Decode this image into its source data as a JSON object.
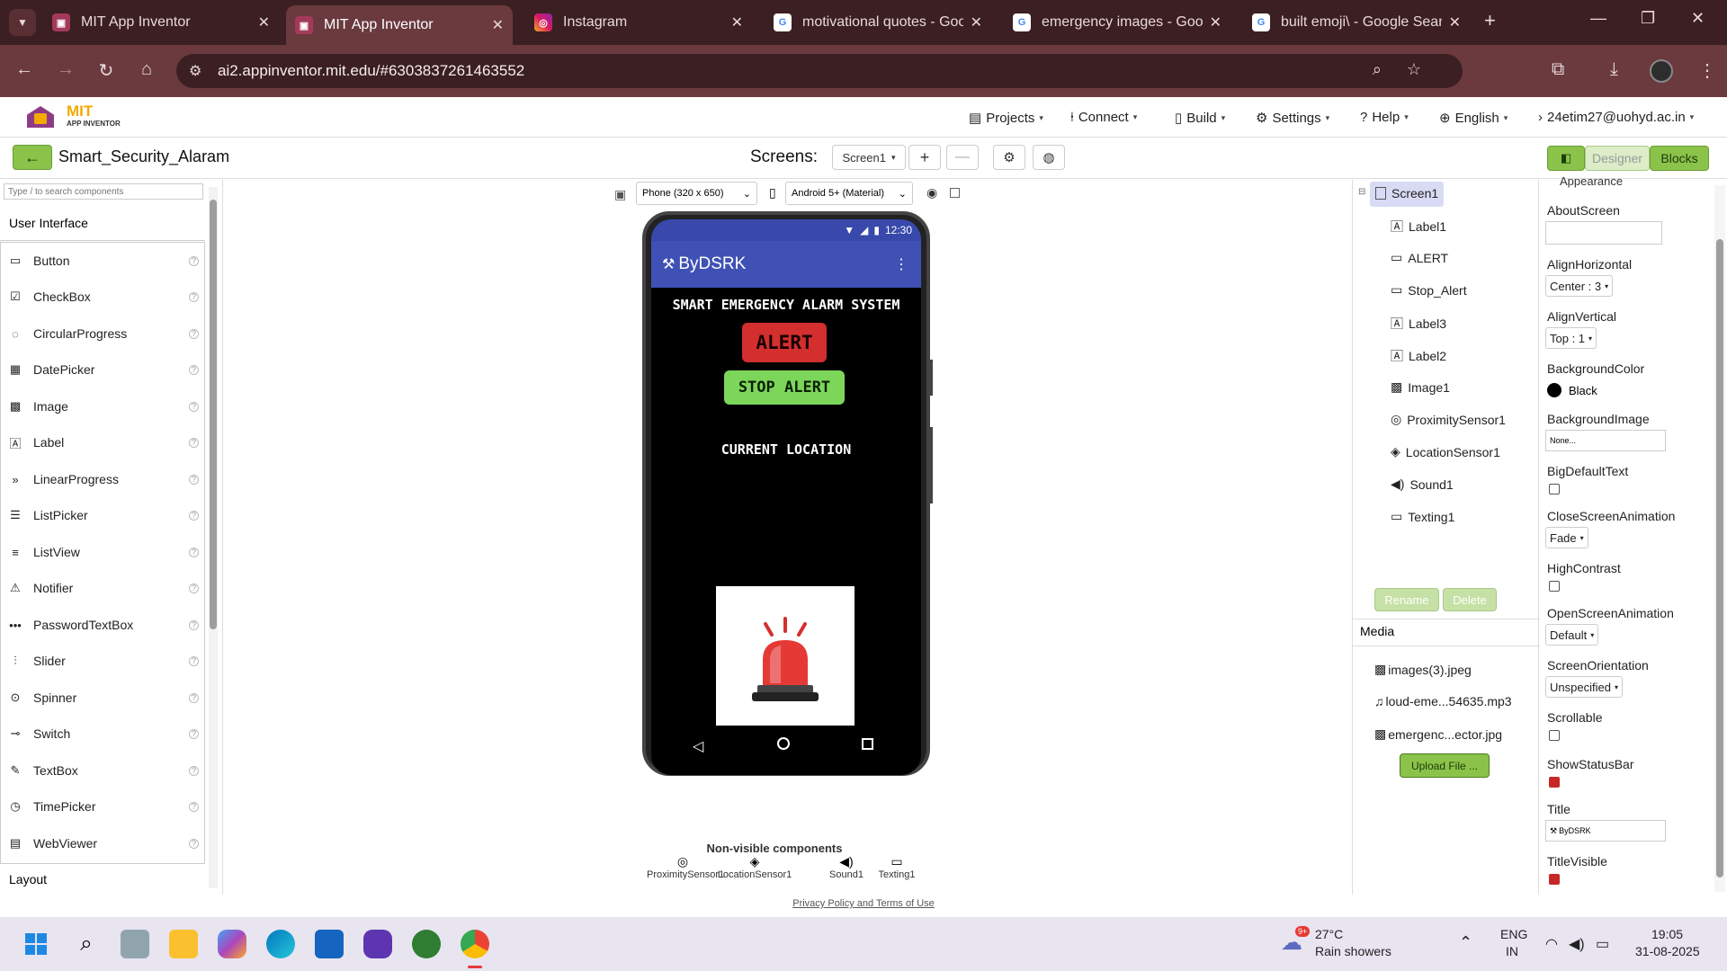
{
  "browser": {
    "tabs": [
      {
        "title": "MIT App Inventor",
        "active": false
      },
      {
        "title": "MIT App Inventor",
        "active": true
      },
      {
        "title": "Instagram",
        "active": false
      },
      {
        "title": "motivational quotes - Goo",
        "active": false
      },
      {
        "title": "emergency images - Goog",
        "active": false
      },
      {
        "title": "built emoji\\ - Google Searc",
        "active": false
      }
    ],
    "url": "ai2.appinventor.mit.edu/#6303837261463552"
  },
  "header": {
    "logo_line1": "MIT",
    "logo_line2": "APP INVENTOR",
    "menus": {
      "projects": "Projects",
      "connect": "Connect",
      "build": "Build",
      "settings": "Settings",
      "help": "Help",
      "language": "English",
      "account": "24etim27@uohyd.ac.in"
    }
  },
  "project": {
    "name": "Smart_Security_Alaram",
    "screens_label": "Screens:",
    "screen_selected": "Screen1",
    "designer_label": "Designer",
    "blocks_label": "Blocks"
  },
  "palette": {
    "search_placeholder": "Type / to search components",
    "category": "User Interface",
    "items": [
      {
        "label": "Button",
        "icon": "button-icon"
      },
      {
        "label": "CheckBox",
        "icon": "checkbox-icon"
      },
      {
        "label": "CircularProgress",
        "icon": "circular-progress-icon"
      },
      {
        "label": "DatePicker",
        "icon": "calendar-icon"
      },
      {
        "label": "Image",
        "icon": "image-icon"
      },
      {
        "label": "Label",
        "icon": "label-icon"
      },
      {
        "label": "LinearProgress",
        "icon": "linear-progress-icon"
      },
      {
        "label": "ListPicker",
        "icon": "list-picker-icon"
      },
      {
        "label": "ListView",
        "icon": "list-view-icon"
      },
      {
        "label": "Notifier",
        "icon": "warning-icon"
      },
      {
        "label": "PasswordTextBox",
        "icon": "password-icon"
      },
      {
        "label": "Slider",
        "icon": "slider-icon"
      },
      {
        "label": "Spinner",
        "icon": "spinner-icon"
      },
      {
        "label": "Switch",
        "icon": "switch-icon"
      },
      {
        "label": "TextBox",
        "icon": "textbox-icon"
      },
      {
        "label": "TimePicker",
        "icon": "clock-icon"
      },
      {
        "label": "WebViewer",
        "icon": "webviewer-icon"
      }
    ],
    "next_category": "Layout"
  },
  "viewer": {
    "device": "Phone (320 x 650)",
    "theme": "Android 5+ (Material)",
    "status_time": "12:30",
    "app_title": "ByDSRK",
    "heading": "SMART EMERGENCY ALARM SYSTEM",
    "alert_button": "ALERT",
    "stop_button": "STOP ALERT",
    "location_label": "CURRENT LOCATION",
    "nonvisible_title": "Non-visible components",
    "nonvisible": [
      "ProximitySensor1",
      "LocationSensor1",
      "Sound1",
      "Texting1"
    ],
    "footer_link": "Privacy Policy and Terms of Use"
  },
  "tree": {
    "root": "Screen1",
    "items": [
      {
        "label": "Label1",
        "icon": "label-icon"
      },
      {
        "label": "ALERT",
        "icon": "button-icon"
      },
      {
        "label": "Stop_Alert",
        "icon": "button-icon"
      },
      {
        "label": "Label3",
        "icon": "label-icon"
      },
      {
        "label": "Label2",
        "icon": "label-icon"
      },
      {
        "label": "Image1",
        "icon": "image-icon"
      },
      {
        "label": "ProximitySensor1",
        "icon": "proximity-icon"
      },
      {
        "label": "LocationSensor1",
        "icon": "location-icon"
      },
      {
        "label": "Sound1",
        "icon": "sound-icon"
      },
      {
        "label": "Texting1",
        "icon": "texting-icon"
      }
    ],
    "rename": "Rename",
    "delete": "Delete",
    "media_title": "Media",
    "media": [
      {
        "label": "images(3).jpeg",
        "icon": "image-file-icon"
      },
      {
        "label": "loud-eme...54635.mp3",
        "icon": "music-file-icon"
      },
      {
        "label": "emergenc...ector.jpg",
        "icon": "image-file-icon"
      }
    ],
    "upload": "Upload File ..."
  },
  "properties": {
    "partial_header": "Appearance",
    "about_screen": "AboutScreen",
    "align_horizontal": "AlignHorizontal",
    "align_horizontal_value": "Center : 3",
    "align_vertical": "AlignVertical",
    "align_vertical_value": "Top : 1",
    "background_color": "BackgroundColor",
    "background_color_value": "Black",
    "background_image": "BackgroundImage",
    "background_image_value": "None...",
    "big_default_text": "BigDefaultText",
    "close_anim": "CloseScreenAnimation",
    "close_anim_value": "Fade",
    "high_contrast": "HighContrast",
    "open_anim": "OpenScreenAnimation",
    "open_anim_value": "Default",
    "orientation": "ScreenOrientation",
    "orientation_value": "Unspecified",
    "scrollable": "Scrollable",
    "show_status_bar": "ShowStatusBar",
    "title": "Title",
    "title_value": "ByDSRK",
    "title_visible": "TitleVisible"
  },
  "taskbar": {
    "weather_temp": "27°C",
    "weather_desc": "Rain showers",
    "weather_badge": "9+",
    "lang1": "ENG",
    "lang2": "IN",
    "time": "19:05",
    "date": "31-08-2025"
  },
  "colors": {
    "accent": "#8bc34a",
    "chrome_dark": "#3c1f22",
    "chrome_mid": "#6a3a3f",
    "alert_red": "#d32f2f",
    "stop_green": "#7cd65a",
    "app_bar": "#3f51b5"
  }
}
